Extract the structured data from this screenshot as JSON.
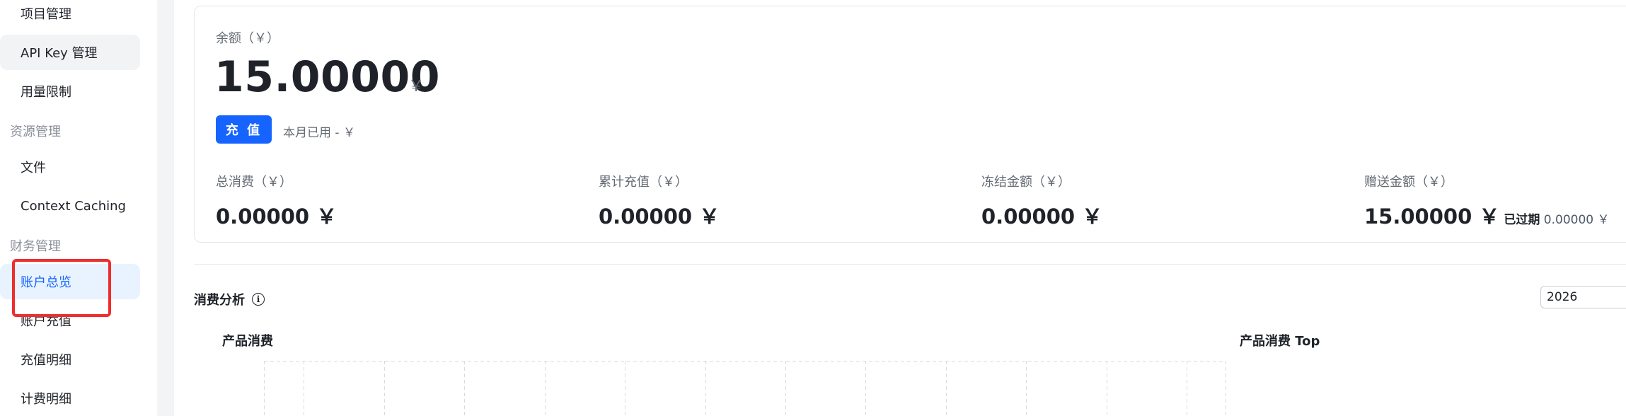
{
  "sidebar": {
    "items": [
      {
        "label": "项目管理",
        "type": "item"
      },
      {
        "label": "API Key 管理",
        "type": "item"
      },
      {
        "label": "用量限制",
        "type": "item"
      },
      {
        "label": "资源管理",
        "type": "group"
      },
      {
        "label": "文件",
        "type": "item"
      },
      {
        "label": "Context Caching",
        "type": "item"
      },
      {
        "label": "财务管理",
        "type": "group"
      },
      {
        "label": "账户总览",
        "type": "item",
        "active": true
      },
      {
        "label": "账户充值",
        "type": "item"
      },
      {
        "label": "充值明细",
        "type": "item"
      },
      {
        "label": "计费明细",
        "type": "item"
      }
    ]
  },
  "balance": {
    "label": "余额（￥）",
    "amount": "15.00000",
    "currency": "￥",
    "recharge_label": "充 值",
    "month_used": "本月已用 - ￥"
  },
  "stats": [
    {
      "label": "总消费（￥）",
      "value": "0.00000 ￥"
    },
    {
      "label": "累计充值（￥）",
      "value": "0.00000 ￥"
    },
    {
      "label": "冻结金额（￥）",
      "value": "0.00000 ￥"
    },
    {
      "label": "赠送金额（￥）",
      "value": "15.00000 ￥",
      "extra_label": "已过期",
      "extra_value": "0.00000 ￥"
    }
  ],
  "analysis": {
    "title": "消费分析",
    "year": "2026",
    "product_title": "产品消费",
    "top_title": "产品消费 Top"
  },
  "colors": {
    "accent": "#1664ff",
    "active_bg": "#e8f3ff",
    "highlight": "#ee2d2d"
  }
}
